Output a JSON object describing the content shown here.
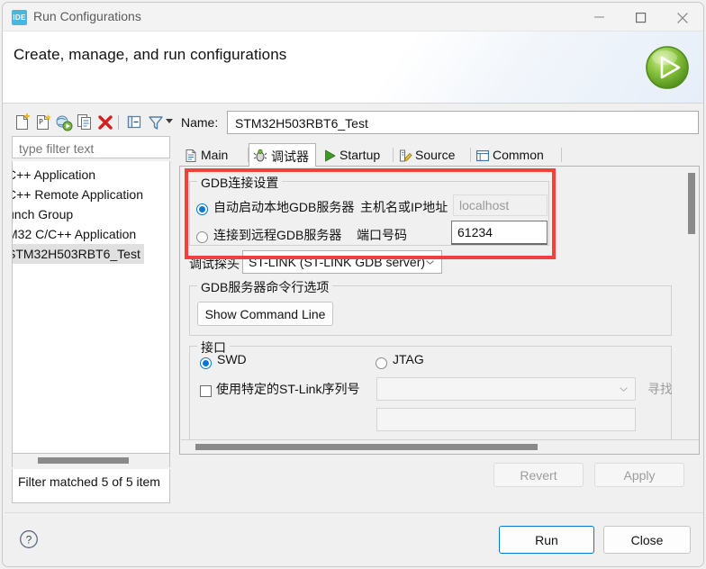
{
  "window": {
    "title": "Run Configurations",
    "icon_label": "IDE",
    "icon_name": "ide-logo-icon",
    "minimize_label": "Minimize",
    "maximize_label": "Maximize",
    "close_label": "Close"
  },
  "banner": {
    "title": "Create, manage, and run configurations",
    "icon_name": "run-launch-icon"
  },
  "left_panel": {
    "toolbar": [
      {
        "name": "new-configuration-icon",
        "tooltip": "New launch configuration"
      },
      {
        "name": "new-prototype-icon",
        "tooltip": "New launch prototype"
      },
      {
        "name": "export-configuration-icon",
        "tooltip": "Export"
      },
      {
        "name": "duplicate-configuration-icon",
        "tooltip": "Duplicate"
      },
      {
        "name": "delete-configuration-icon",
        "tooltip": "Delete"
      },
      {
        "name": "collapse-all-icon",
        "tooltip": "Collapse All"
      },
      {
        "name": "filter-icon",
        "tooltip": "Filter launch configurations"
      },
      {
        "name": "toolbar-overflow-arrow-icon",
        "tooltip": "More"
      }
    ],
    "filter": {
      "placeholder": "type filter text",
      "value": ""
    },
    "tree_items": [
      {
        "label": "C++ Application",
        "selected": false
      },
      {
        "label": "C++ Remote Application",
        "selected": false
      },
      {
        "label": "unch Group",
        "selected": false
      },
      {
        "label": "M32 C/C++ Application",
        "selected": false
      },
      {
        "label": "STM32H503RBT6_Test",
        "selected": true
      }
    ],
    "status": "Filter matched 5 of 5 item"
  },
  "right_panel": {
    "name_label": "Name:",
    "name_value": "STM32H503RBT6_Test",
    "tabs": [
      {
        "label": "Main",
        "icon": "document-icon",
        "active": false
      },
      {
        "label": "调试器",
        "icon": "debugger-bug-icon",
        "active": true
      },
      {
        "label": "Startup",
        "icon": "green-play-icon",
        "active": false
      },
      {
        "label": "Source",
        "icon": "source-pencil-icon",
        "active": false
      },
      {
        "label": "Common",
        "icon": "common-table-icon",
        "active": false
      }
    ],
    "gdb_group": {
      "title": "GDB连接设置",
      "auto_start_label": "自动启动本地GDB服务器",
      "auto_start_selected": true,
      "remote_label": "连接到远程GDB服务器",
      "remote_selected": false,
      "host_label": "主机名或IP地址",
      "host_value": "localhost",
      "host_enabled": false,
      "port_label": "端口号码",
      "port_value": "61234",
      "port_enabled": true
    },
    "probe": {
      "label": "调试探头",
      "value": "ST-LINK (ST-LINK GDB server)"
    },
    "server_options": {
      "title": "GDB服务器命令行选项",
      "show_command_line_label": "Show Command Line"
    },
    "interface_group": {
      "title": "接口",
      "swd_label": "SWD",
      "swd_selected": true,
      "jtag_label": "JTAG",
      "jtag_selected": false,
      "serial_checkbox_label": "使用特定的ST-Link序列号",
      "serial_checked": false,
      "serial_value": "",
      "search_button_label": "寻找",
      "search_enabled": false
    },
    "apply_row": {
      "revert_label": "Revert",
      "revert_enabled": false,
      "apply_label": "Apply",
      "apply_enabled": false
    }
  },
  "footer": {
    "help_icon": "help-question-icon",
    "run_label": "Run",
    "close_label": "Close"
  },
  "colors": {
    "accent": "#0078d4",
    "annotation": "#f43f3f",
    "selection": "#e0e0e0"
  }
}
